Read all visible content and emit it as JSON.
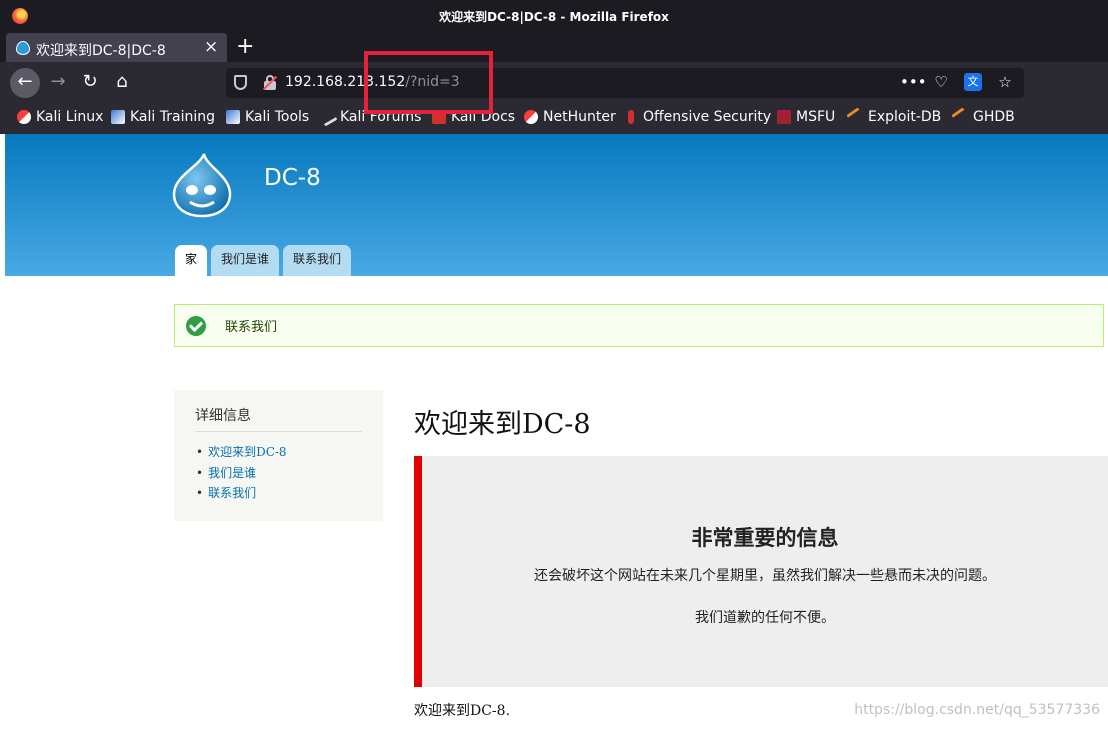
{
  "window": {
    "title": "欢迎来到DC-8|DC-8 - Mozilla Firefox"
  },
  "tab": {
    "title": "欢迎来到DC-8|DC-8",
    "close": "×",
    "new_tab": "+"
  },
  "nav": {
    "back": "←",
    "forward": "→",
    "reload": "↻",
    "home": "⌂"
  },
  "urlbar": {
    "url_host": "192.168.213.152",
    "url_rest": "/?nid=3",
    "more": "•••"
  },
  "bookmarks": [
    {
      "label": "Kali Linux",
      "icon": "kali-icon"
    },
    {
      "label": "Kali Training",
      "icon": "kali-training-icon"
    },
    {
      "label": "Kali Tools",
      "icon": "kali-tools-icon"
    },
    {
      "label": "Kali Forums",
      "icon": "kali-forums-icon"
    },
    {
      "label": "Kali Docs",
      "icon": "kali-docs-icon"
    },
    {
      "label": "NetHunter",
      "icon": "nethunter-icon"
    },
    {
      "label": "Offensive Security",
      "icon": "offsec-icon"
    },
    {
      "label": "MSFU",
      "icon": "msfu-icon"
    },
    {
      "label": "Exploit-DB",
      "icon": "exploit-db-icon"
    },
    {
      "label": "GHDB",
      "icon": "ghdb-icon"
    }
  ],
  "site": {
    "name": "DC-8",
    "tabs": [
      {
        "label": "家",
        "active": true
      },
      {
        "label": "我们是谁",
        "active": false
      },
      {
        "label": "联系我们",
        "active": false
      }
    ],
    "message": "联系我们",
    "sidebar": {
      "title": "详细信息",
      "links": [
        "欢迎来到DC-8",
        "我们是谁",
        "联系我们"
      ]
    },
    "main_title": "欢迎来到DC-8",
    "callout": {
      "heading": "非常重要的信息",
      "line1": "还会破坏这个网站在未来几个星期里，虽然我们解决一些悬而未决的问题。",
      "line2": "我们道歉的任何不便。"
    },
    "body_text": "欢迎来到DC-8."
  },
  "watermark": "https://blog.csdn.net/qq_53577336",
  "colors": {
    "accent": "#0779bf",
    "highlight_box": "#e5213b",
    "callout_border": "#e30000"
  }
}
